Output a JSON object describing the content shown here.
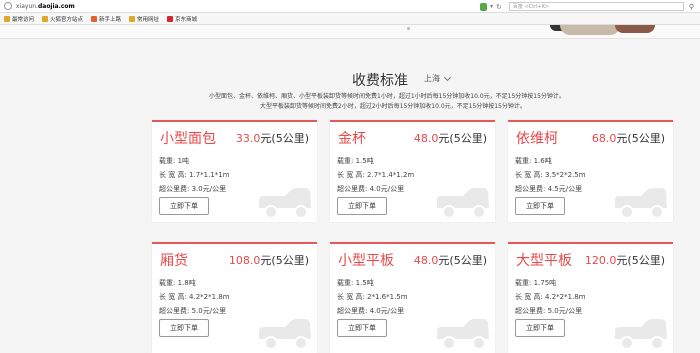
{
  "browser": {
    "url_prefix": "xiayun.",
    "url_domain": "daojia.com",
    "search_placeholder": "百度 <Ctrl+K>",
    "bookmarks": [
      {
        "label": "最常访问",
        "icon": "star-folder-icon",
        "color": "#e4a52b"
      },
      {
        "label": "火狐官方站点",
        "icon": "folder-icon",
        "color": "#e4a52b"
      },
      {
        "label": "新手上路",
        "icon": "firefox-icon",
        "color": "#e2632b"
      },
      {
        "label": "常用网址",
        "icon": "folder-icon",
        "color": "#e4a52b"
      },
      {
        "label": "京东商城",
        "icon": "jd-icon",
        "color": "#d9232d"
      }
    ]
  },
  "page": {
    "title": "收费标准",
    "city": "上海",
    "desc_line1": "小型面包、金杯、依维柯、厢货、小型平板装卸货等候时间免费1小时，超过1小时后每15分钟加收10.0元，不足15分钟按15分钟计。",
    "desc_line2": "大型平板装卸货等候时间免费2小时，超过2小时后每15分钟加收10.0元，不足15分钟按15分钟计。"
  },
  "labels": {
    "load": "载重: ",
    "dims": "长 宽 高: ",
    "extra": "超公里费: ",
    "unit_suffix": "元(5公里)",
    "order": "立即下单"
  },
  "vehicles": [
    {
      "name": "小型面包",
      "price": "33.0",
      "load": "1吨",
      "dims": "1.7*1.1*1m",
      "extra": "3.0元/公里"
    },
    {
      "name": "金杯",
      "price": "48.0",
      "load": "1.5吨",
      "dims": "2.7*1.4*1.2m",
      "extra": "4.0元/公里"
    },
    {
      "name": "依维柯",
      "price": "68.0",
      "load": "1.6吨",
      "dims": "3.5*2*2.5m",
      "extra": "4.5元/公里"
    },
    {
      "name": "厢货",
      "price": "108.0",
      "load": "1.8吨",
      "dims": "4.2*2*1.8m",
      "extra": "5.0元/公里"
    },
    {
      "name": "小型平板",
      "price": "48.0",
      "load": "1.5吨",
      "dims": "2*1.6*1.5m",
      "extra": "4.0元/公里"
    },
    {
      "name": "大型平板",
      "price": "120.0",
      "load": "1.75吨",
      "dims": "4.2*2*1.8m",
      "extra": "5.0元/公里"
    }
  ],
  "colors": {
    "accent": "#e54a4a",
    "car_icon": "#e9e9e9"
  }
}
